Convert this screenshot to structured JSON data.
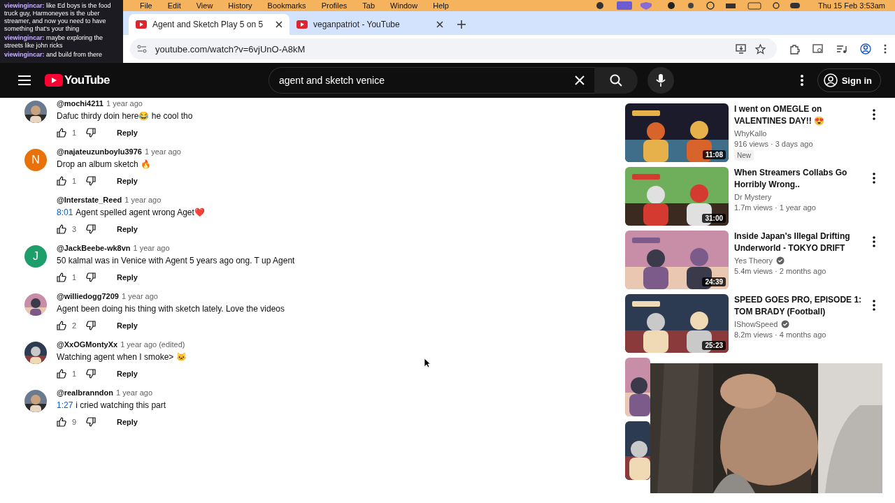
{
  "menu_bar": {
    "items": [
      "File",
      "Edit",
      "View",
      "History",
      "Bookmarks",
      "Profiles",
      "Tab",
      "Window",
      "Help"
    ],
    "clock": "Thu 15 Feb 3:53am"
  },
  "tabs": [
    {
      "title": "Agent and Sketch Play 5 on 5",
      "selected": true
    },
    {
      "title": "veganpatriot - YouTube",
      "selected": false
    }
  ],
  "address": {
    "url": "youtube.com/watch?v=6vjUnO-A8kM"
  },
  "masthead": {
    "logo": "YouTube",
    "search": "agent and sketch venice",
    "sign_in": "Sign in"
  },
  "comments": [
    {
      "author": "@mochi4211",
      "time": "1 year ago",
      "text": "Dafuc thirdy doin here😂 he cool tho",
      "likes": "1",
      "reply": "Reply"
    },
    {
      "author": "@najateuzunboylu3976",
      "time": "1 year ago",
      "text": "Drop an album sketch 🔥",
      "likes": "1",
      "reply": "Reply",
      "avatar": {
        "kind": "letter",
        "letter": "N",
        "color": "#e8710a"
      }
    },
    {
      "author": "@Interstate_Reed",
      "time": "1 year ago",
      "link": "8:01",
      "text": "Agent spelled agent wrong Aget❤️",
      "likes": "3",
      "reply": "Reply",
      "avatar": {
        "kind": "none"
      }
    },
    {
      "author": "@JackBeebe-wk8vn",
      "time": "1 year ago",
      "text": "50 kalmal was in Venice with Agent 5 years ago ong. T up Agent",
      "likes": "1",
      "reply": "Reply",
      "avatar": {
        "kind": "letter",
        "letter": "J",
        "color": "#1e9e6a"
      }
    },
    {
      "author": "@williedogg7209",
      "time": "1 year ago",
      "text": "Agent been doing his thing with sketch lately. Love the videos",
      "likes": "2",
      "reply": "Reply"
    },
    {
      "author": "@XxOGMontyXx",
      "time": "1 year ago (edited)",
      "text": "Watching agent when I smoke> 🐱",
      "likes": "1",
      "reply": "Reply"
    },
    {
      "author": "@realbranndon",
      "time": "1 year ago",
      "link": "1:27",
      "text": "i cried watching this part",
      "likes": "9",
      "reply": "Reply"
    }
  ],
  "videos": [
    {
      "title": "I went on OMEGLE on VALENTINES DAY!! 😍",
      "channel": "WhyKallo",
      "verified": false,
      "meta": "916 views · 3 days ago",
      "badge": "New",
      "duration": "11:08"
    },
    {
      "title": "When Streamers Collabs Go Horribly Wrong..",
      "channel": "Dr Mystery",
      "verified": false,
      "meta": "1.7m views · 1 year ago",
      "duration": "31:00"
    },
    {
      "title": "Inside Japan's Illegal Drifting Underworld - TOKYO DRIFT",
      "channel": "Yes Theory",
      "verified": true,
      "meta": "5.4m views · 2 months ago",
      "duration": "24:39"
    },
    {
      "title": "SPEED GOES PRO, EPISODE 1: TOM BRADY  (Football)",
      "channel": "IShowSpeed",
      "verified": true,
      "meta": "8.2m views · 4 months ago",
      "duration": "25:23"
    }
  ],
  "chat_overlay": [
    {
      "user": "viewingincar:",
      "text": "like Ed boys is the food truck guy, Harmoneyes is the uber streamer, and now you need to have something that's your thing"
    },
    {
      "user": "viewingincar:",
      "text": "maybe exploring the streets like john ricks"
    },
    {
      "user": "viewingincar:",
      "text": "and build from there"
    }
  ]
}
